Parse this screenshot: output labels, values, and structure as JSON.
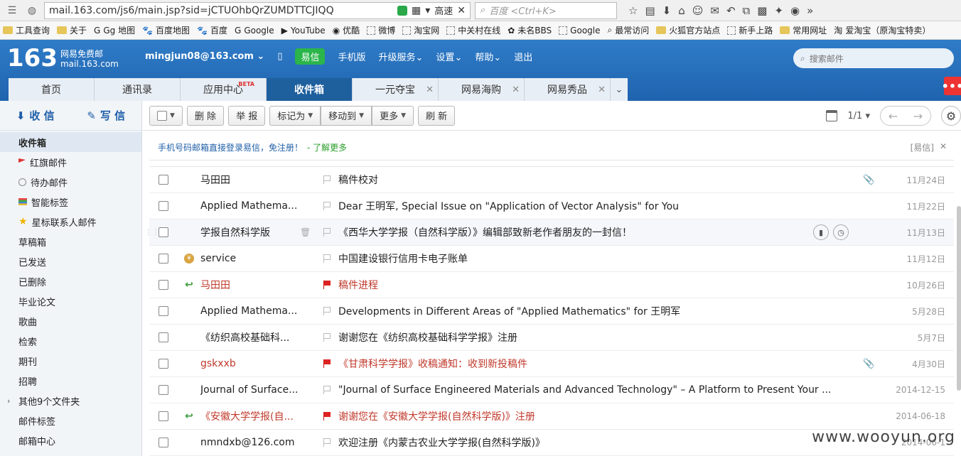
{
  "browser": {
    "url": "mail.163.com/js6/main.jsp?sid=jCTUOhbQrZUMDTTCJIQQ",
    "speed_label": "高速",
    "search_placeholder": "百度 <Ctrl+K>"
  },
  "bookmarks": [
    {
      "label": "工具查询",
      "icon": "folder-icon"
    },
    {
      "label": "关于",
      "icon": "folder-icon"
    },
    {
      "label": "Gg 地图",
      "icon": "google-icon"
    },
    {
      "label": "百度地图",
      "icon": "baidu-icon"
    },
    {
      "label": "百度",
      "icon": "baidu-icon"
    },
    {
      "label": "Google",
      "icon": "google-icon"
    },
    {
      "label": "YouTube",
      "icon": "youtube-icon"
    },
    {
      "label": "优酷",
      "icon": "youku-icon"
    },
    {
      "label": "微博",
      "icon": "page-icon"
    },
    {
      "label": "淘宝网",
      "icon": "page-icon"
    },
    {
      "label": "中关村在线",
      "icon": "page-icon"
    },
    {
      "label": "未名BBS",
      "icon": "bbs-icon"
    },
    {
      "label": "Google",
      "icon": "page-icon"
    },
    {
      "label": "最常访问",
      "icon": "search-icon"
    },
    {
      "label": "火狐官方站点",
      "icon": "folder-icon"
    },
    {
      "label": "新手上路",
      "icon": "page-icon"
    },
    {
      "label": "常用网址",
      "icon": "folder-icon"
    },
    {
      "label": "爱淘宝（原淘宝特卖）",
      "icon": "taobao-icon"
    }
  ],
  "header": {
    "logo_number": "163",
    "logo_line1": "网易免费邮",
    "logo_line2": "mail.163.com",
    "user": "mingjun08@163.com",
    "yixin": "易信",
    "links": [
      "手机版",
      "升级服务",
      "设置",
      "帮助",
      "退出"
    ],
    "search_placeholder": "搜索邮件"
  },
  "tabs": [
    {
      "label": "首页"
    },
    {
      "label": "通讯录"
    },
    {
      "label": "应用中心",
      "badge": "BETA"
    },
    {
      "label": "收件箱",
      "active": true
    },
    {
      "label": "一元夺宝",
      "closable": true
    },
    {
      "label": "网易海购",
      "closable": true
    },
    {
      "label": "网易秀品",
      "closable": true
    }
  ],
  "sidebar": {
    "receive": "收 信",
    "compose": "写 信",
    "folders": [
      {
        "label": "收件箱",
        "active": true
      },
      {
        "label": "红旗邮件",
        "icon": "flag"
      },
      {
        "label": "待办邮件",
        "icon": "clock"
      },
      {
        "label": "智能标签",
        "icon": "tag"
      },
      {
        "label": "星标联系人邮件",
        "icon": "star"
      },
      {
        "label": "草稿箱"
      },
      {
        "label": "已发送"
      },
      {
        "label": "已删除"
      },
      {
        "label": "毕业论文"
      },
      {
        "label": "歌曲"
      },
      {
        "label": "检索"
      },
      {
        "label": "期刊"
      },
      {
        "label": "招聘"
      },
      {
        "label": "其他9个文件夹",
        "expandable": true
      },
      {
        "label": "邮件标签"
      },
      {
        "label": "邮箱中心"
      }
    ]
  },
  "toolbar": {
    "delete": "删 除",
    "report": "举 报",
    "mark_as": "标记为",
    "move_to": "移动到",
    "more": "更多",
    "refresh": "刷 新",
    "page": "1/1"
  },
  "banner": {
    "text": "手机号码邮箱直接登录易信，免注册！",
    "learn_more": "- 了解更多",
    "tag": "[易信]"
  },
  "emails": [
    {
      "from": "马田田",
      "subject": "稿件校对",
      "date": "11月24日",
      "attachment": true
    },
    {
      "from": "Applied Mathema...",
      "subject": "Dear 王明军, Special Issue on \"Application of Vector Analysis\" for You",
      "date": "11月22日"
    },
    {
      "from": "学报自然科学版",
      "subject": "《西华大学学报（自然科学版）》编辑部致新老作者朋友的一封信！",
      "date": "11月13日",
      "hover": true
    },
    {
      "from": "service",
      "subject": "中国建设银行信用卡电子账单",
      "date": "11月12日",
      "coin": true
    },
    {
      "from": "马田田",
      "subject": "稿件进程",
      "date": "10月26日",
      "red": true,
      "replied": true,
      "flagged": true
    },
    {
      "from": "Applied Mathema...",
      "subject": "Developments in Different Areas of \"Applied Mathematics\" for 王明军",
      "date": "5月28日"
    },
    {
      "from": "《纺织高校基础科...",
      "subject": "谢谢您在《纺织高校基础科学学报》注册",
      "date": "5月7日"
    },
    {
      "from": "gskxxb",
      "subject": "《甘肃科学学报》收稿通知：收到新投稿件",
      "date": "4月30日",
      "red": true,
      "flagged": true,
      "attachment": true
    },
    {
      "from": "Journal of Surface...",
      "subject": "\"Journal of Surface Engineered Materials and Advanced Technology\" – A Platform to Present Your ...",
      "date": "2014-12-15"
    },
    {
      "from": "《安徽大学学报(自...",
      "subject": "谢谢您在《安徽大学学报(自然科学版)》注册",
      "date": "2014-06-18",
      "red": true,
      "replied": true,
      "flagged": true
    },
    {
      "from": "nmndxb@126.com",
      "subject": "欢迎注册《内蒙古农业大学学报(自然科学版)》",
      "date": "2014-06-1"
    }
  ],
  "watermark": "www.wooyun.org"
}
